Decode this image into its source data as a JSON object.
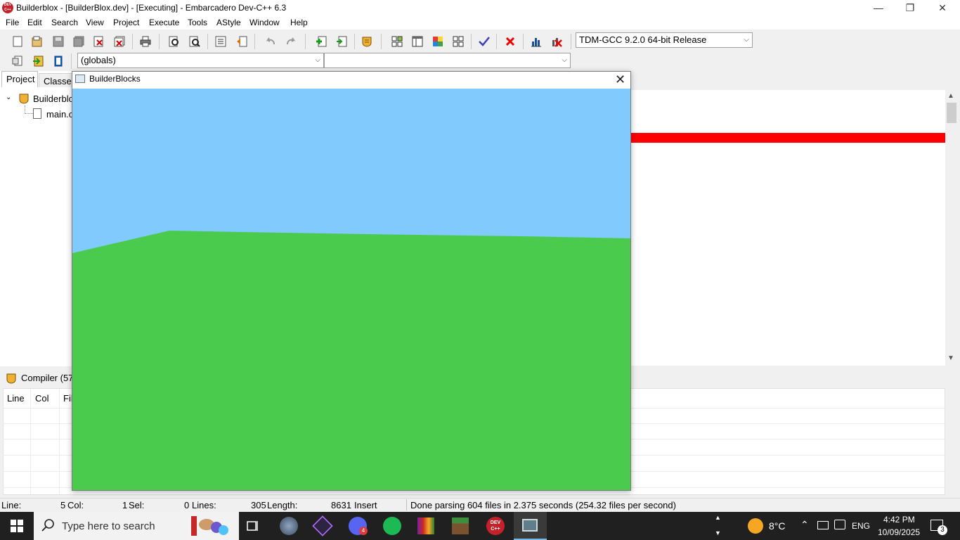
{
  "window": {
    "title": "Builderblox - [BuilderBlox.dev] - [Executing] - Embarcadero Dev-C++ 6.3",
    "icon_label": "DEV C++"
  },
  "window_controls": {
    "minimize": "—",
    "maximize": "❐",
    "close": "✕"
  },
  "menu": [
    "File",
    "Edit",
    "Search",
    "View",
    "Project",
    "Execute",
    "Tools",
    "AStyle",
    "Window",
    "Help"
  ],
  "compiler_select": "TDM-GCC 9.2.0 64-bit Release",
  "scope_select": "(globals)",
  "member_select": "",
  "left_tabs": {
    "project": "Project",
    "classes": "Classe"
  },
  "project_tree": {
    "root": "Builderblo",
    "child": "main.c"
  },
  "bottom": {
    "compiler_tab": "Compiler (57)",
    "columns": [
      "Line",
      "Col",
      "Fil"
    ]
  },
  "status": {
    "line_label": "Line:",
    "line_value": "5",
    "col_label": "Col:",
    "col_value": "1",
    "sel_label": "Sel:",
    "sel_value": "0",
    "lines_label": "Lines:",
    "lines_value": "305",
    "length_label": "Length:",
    "length_value": "8631",
    "mode": "Insert",
    "message": "Done parsing 604 files in 2.375 seconds (254.32 files per second)"
  },
  "popup": {
    "title": "BuilderBlocks",
    "close": "✕"
  },
  "colors": {
    "sky": "#80cafd",
    "ground": "#4bcb4e",
    "breakpoint_line": "#ff0000"
  },
  "taskbar": {
    "search_placeholder": "Type here to search",
    "weather": "8°C",
    "language": "ENG",
    "time": "4:42 PM",
    "date": "10/09/2025",
    "notifications": "3",
    "discord_badge": "4"
  }
}
